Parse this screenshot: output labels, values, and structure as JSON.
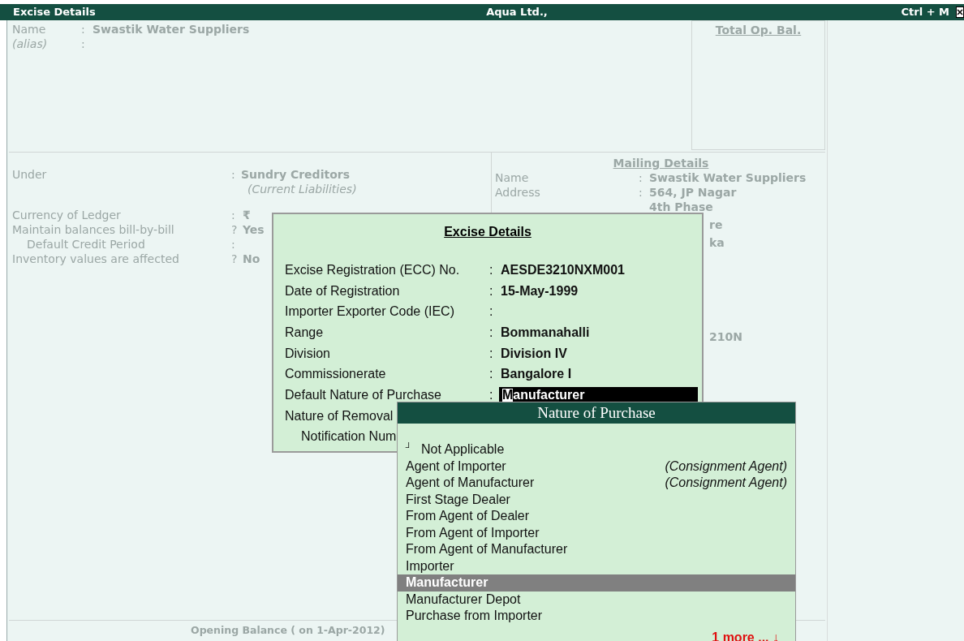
{
  "title_bar": {
    "title": "Excise Details",
    "company": "Aqua Ltd.,",
    "shortcut": "Ctrl + M"
  },
  "ledger": {
    "name": {
      "label": "Name",
      "sep": ":",
      "value": "Swastik Water Suppliers"
    },
    "alias": {
      "label": "(alias)",
      "sep": ":"
    },
    "total_op_bal": "Total Op. Bal.",
    "under": {
      "label": "Under",
      "sep": ":",
      "value": "Sundry Creditors",
      "note": "(Current Liabilities)"
    },
    "fields": [
      {
        "label": "Currency of Ledger",
        "sep": ":",
        "value": "₹"
      },
      {
        "label": "Maintain balances bill-by-bill",
        "sep": "?",
        "value": "Yes",
        "children": [
          {
            "label": "Default Credit Period",
            "sep": ":"
          }
        ]
      },
      {
        "label": "Inventory values are affected",
        "sep": "?",
        "value": "No"
      }
    ],
    "mailing": {
      "heading": "Mailing Details",
      "rows": [
        {
          "label": "Name",
          "sep": ":",
          "value": "Swastik Water Suppliers"
        },
        {
          "label": "Address",
          "sep": ":",
          "value": "564, JP Nagar"
        },
        {
          "value": "4th Phase"
        }
      ],
      "fragments": [
        "re",
        "ka",
        "210N"
      ]
    },
    "opening_balance": "Opening Balance ( on 1-Apr-2012)"
  },
  "excise_dialog": {
    "title": "Excise Details",
    "fields": [
      {
        "label": "Excise Registration (ECC) No.",
        "sep": ":",
        "value": "AESDE3210NXM001",
        "editing": false
      },
      {
        "label": "Date of Registration",
        "sep": ":",
        "value": "15-May-1999",
        "editing": false
      },
      {
        "label": "Importer Exporter Code (IEC)",
        "sep": ":",
        "editing": false
      },
      {
        "label": "Range",
        "sep": ":",
        "value": "Bommanahalli",
        "editing": false
      },
      {
        "label": "Division",
        "sep": ":",
        "value": "Division IV",
        "editing": false
      },
      {
        "label": "Commissionerate",
        "sep": ":",
        "value": "Bangalore I",
        "editing": false
      },
      {
        "label": "Default Nature of Purchase",
        "sep": ":",
        "value": "Manufacturer",
        "editing": true
      },
      {
        "label": "Nature of Removal",
        "children": [
          {
            "label": "Notification Num"
          }
        ]
      }
    ]
  },
  "nature_of_purchase": {
    "title": "Nature of Purchase",
    "items": [
      {
        "marker": "┘",
        "label": "Not Applicable",
        "selected": false
      },
      {
        "label": "Agent of Importer",
        "note": "(Consignment Agent)",
        "selected": false
      },
      {
        "label": "Agent of Manufacturer",
        "note": "(Consignment Agent)",
        "selected": false
      },
      {
        "label": "First Stage Dealer",
        "selected": false
      },
      {
        "label": "From Agent of Dealer",
        "selected": false
      },
      {
        "label": "From Agent of Importer",
        "selected": false
      },
      {
        "label": "From Agent of Manufacturer",
        "selected": false
      },
      {
        "label": "Importer",
        "selected": false
      },
      {
        "label": "Manufacturer",
        "selected": true
      },
      {
        "label": "Manufacturer Depot",
        "selected": false
      },
      {
        "label": "Purchase from Importer",
        "selected": false
      }
    ],
    "more": "1 more ... ↓"
  }
}
